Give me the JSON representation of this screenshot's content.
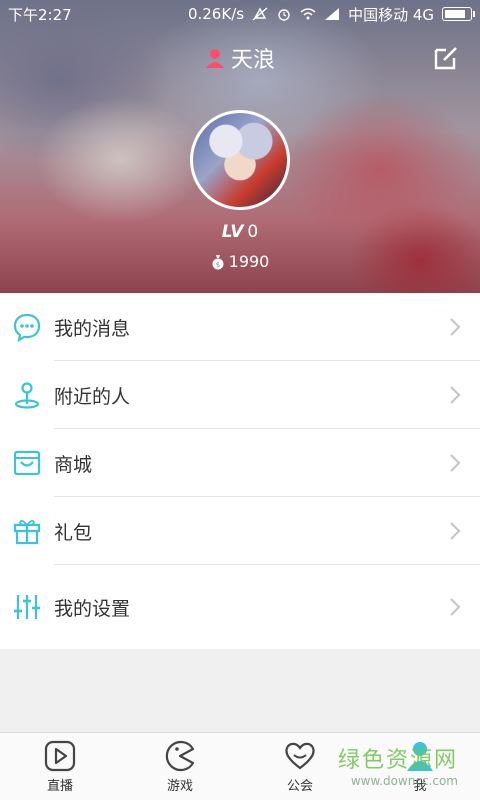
{
  "status_bar": {
    "time": "下午2:27",
    "speed": "0.26K/s",
    "carrier": "中国移动 4G"
  },
  "header": {
    "username": "天浪",
    "level_prefix": "LV",
    "level_value": "0",
    "coins": "1990"
  },
  "menu": [
    {
      "label": "我的消息",
      "icon": "message-bubble-icon"
    },
    {
      "label": "附近的人",
      "icon": "location-pin-icon"
    },
    {
      "label": "商城",
      "icon": "shop-bag-icon"
    },
    {
      "label": "礼包",
      "icon": "gift-icon"
    },
    {
      "label": "我的设置",
      "icon": "settings-sliders-icon"
    }
  ],
  "bottom_nav": [
    {
      "label": "直播",
      "icon": "play-icon"
    },
    {
      "label": "游戏",
      "icon": "pacman-icon"
    },
    {
      "label": "公会",
      "icon": "heart-icon"
    },
    {
      "label": "我",
      "icon": "person-icon"
    }
  ],
  "watermark": {
    "line1": "绿色资源网",
    "line2": "www.downcc.com"
  },
  "colors": {
    "accent": "#3ec3d6",
    "username_icon": "#ff4d6d",
    "chevron": "#c4c4c4"
  }
}
